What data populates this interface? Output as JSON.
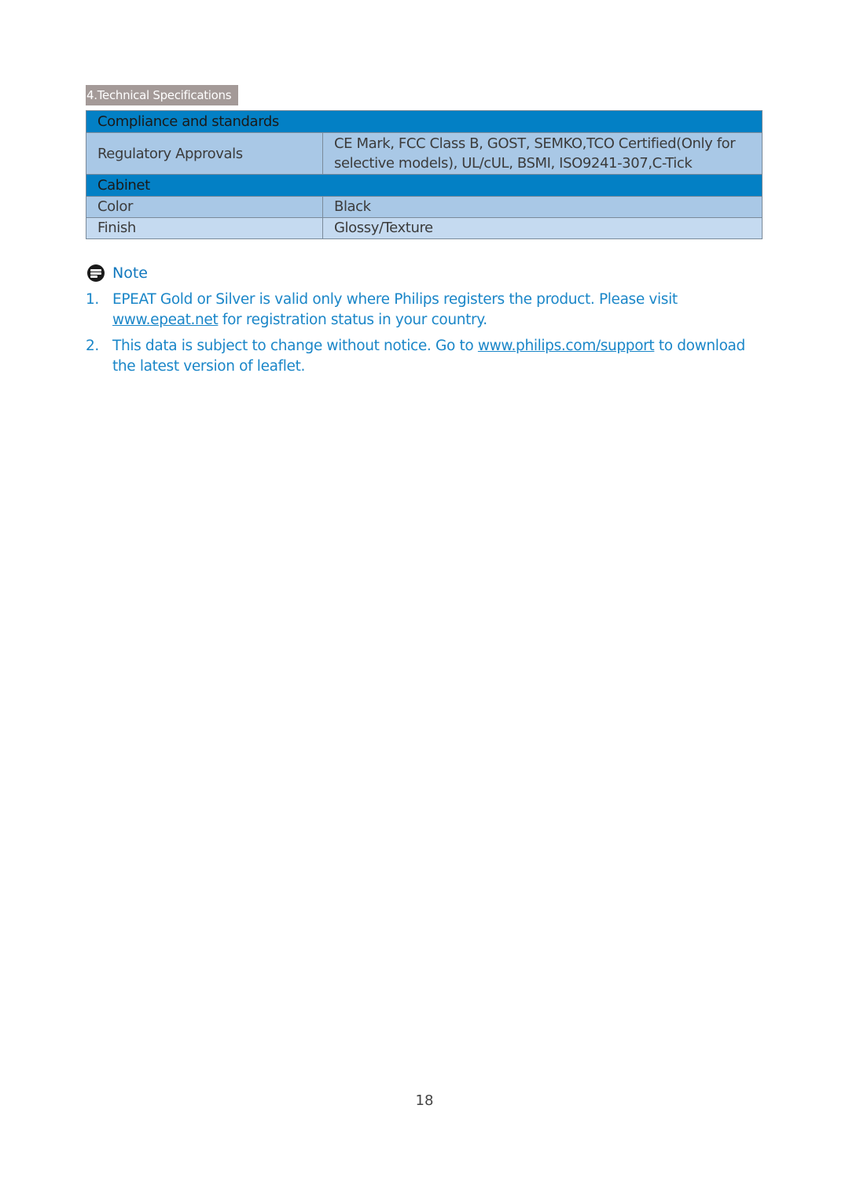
{
  "header": {
    "section_label": "4.Technical Specifications"
  },
  "spec_table": {
    "sections": [
      {
        "title": "Compliance and standards",
        "rows": [
          {
            "label": "Regulatory Approvals",
            "value": "CE Mark, FCC Class B, GOST, SEMKO,TCO Certified(Only for selective models), UL/cUL,  BSMI, ISO9241-307,C-Tick"
          }
        ]
      },
      {
        "title": "Cabinet",
        "rows": [
          {
            "label": "Color",
            "value": "Black"
          },
          {
            "label": "Finish",
            "value": "Glossy/Texture"
          }
        ]
      }
    ]
  },
  "note": {
    "icon": "note-icon",
    "title": "Note",
    "items": [
      {
        "num": "1.",
        "text_before": "EPEAT Gold or Silver is valid only where Philips registers the product. Please visit ",
        "link": "www.epeat.net",
        "text_after": " for registration status in your country."
      },
      {
        "num": "2.",
        "text_before": "This data is subject to change without notice. Go to ",
        "link": "www.philips.com/support",
        "text_after": " to download the latest version of leaflet."
      }
    ]
  },
  "footer": {
    "page_number": "18"
  },
  "colors": {
    "header_blue": "#0380c5",
    "row_blue": "#a9c8e6",
    "row_light_blue": "#c5daf0",
    "tab_gray": "#a49a98",
    "note_blue": "#1a86c8"
  }
}
